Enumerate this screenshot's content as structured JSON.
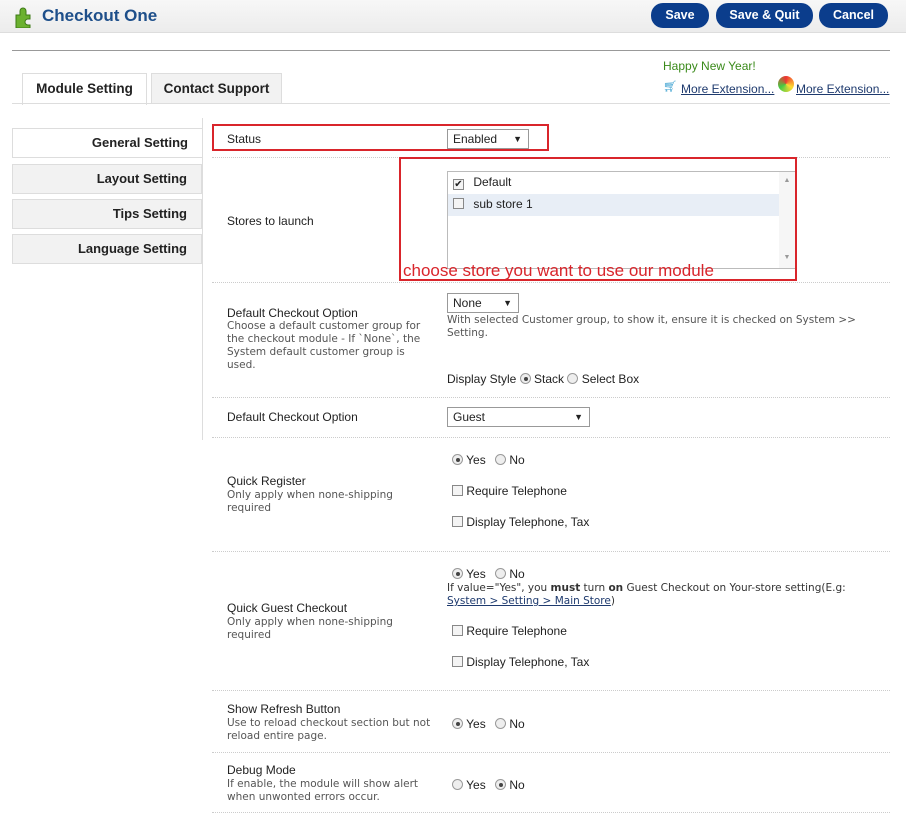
{
  "header": {
    "title": "Checkout One",
    "save": "Save",
    "save_quit": "Save & Quit",
    "cancel": "Cancel",
    "icon": "puzzle-icon"
  },
  "promo": {
    "greeting": "Happy New Year!",
    "link1": "More Extension...",
    "link2": "More Extension..."
  },
  "tabs": [
    "Module Setting",
    "Contact Support"
  ],
  "sidebar": [
    "General Setting",
    "Layout Setting",
    "Tips Setting",
    "Language Setting"
  ],
  "status": {
    "label": "Status",
    "value": "Enabled"
  },
  "stores": {
    "label": "Stores to launch",
    "items": [
      {
        "name": "Default",
        "checked": true
      },
      {
        "name": "sub store 1",
        "checked": false
      }
    ],
    "annotation": "choose store you want to use our module"
  },
  "default_group": {
    "label": "Default Checkout Option",
    "hint": "Choose a default customer group for the checkout module - If `None`, the System default customer group is used.",
    "value": "None",
    "note": "With selected Customer group, to show it, ensure it is checked on System >> Setting.",
    "display_style_label": "Display Style",
    "opt_stack": "Stack",
    "opt_select": "Select Box",
    "selected": "Stack"
  },
  "default_option": {
    "label": "Default Checkout Option",
    "value": "Guest"
  },
  "quick_register": {
    "label": "Quick Register",
    "hint": "Only apply when none-shipping required",
    "yes": "Yes",
    "no": "No",
    "selected": "Yes",
    "require_tel": "Require Telephone",
    "display_tel": "Display Telephone, Tax"
  },
  "quick_guest": {
    "label": "Quick Guest Checkout",
    "hint": "Only apply when none-shipping required",
    "yes": "Yes",
    "no": "No",
    "selected": "Yes",
    "note_a": "If value=\"Yes\", you ",
    "note_b": "must",
    "note_c": " turn ",
    "note_d": "on",
    "note_e": " Guest Checkout on Your-store setting(E.g: ",
    "note_link": "System > Setting > Main Store",
    "note_f": ")",
    "require_tel": "Require Telephone",
    "display_tel": "Display Telephone, Tax"
  },
  "refresh": {
    "label": "Show Refresh Button",
    "hint": "Use to reload checkout section but not reload entire page.",
    "yes": "Yes",
    "no": "No",
    "selected": "Yes"
  },
  "debug": {
    "label": "Debug Mode",
    "hint": "If enable, the module will show alert when unwonted errors occur.",
    "yes": "Yes",
    "no": "No",
    "selected": "No"
  },
  "colors": {
    "brand": "#0b3d8c",
    "title": "#1e4f8a",
    "annotation": "#d9252b",
    "greeting": "#3a8a1a"
  }
}
